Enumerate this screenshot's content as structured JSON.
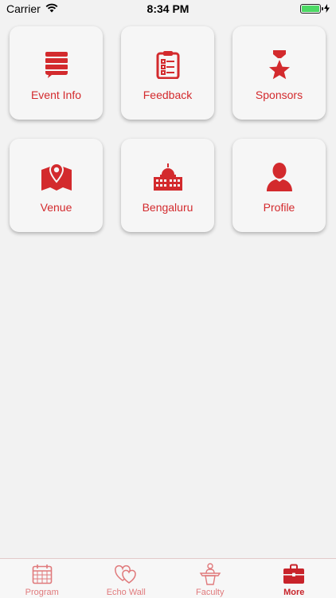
{
  "status_bar": {
    "carrier": "Carrier",
    "time": "8:34 PM",
    "battery_level": 1.0
  },
  "tiles": [
    {
      "label": "Event Info",
      "icon": "event-info-icon"
    },
    {
      "label": "Feedback",
      "icon": "clipboard-icon"
    },
    {
      "label": "Sponsors",
      "icon": "medal-icon"
    },
    {
      "label": "Venue",
      "icon": "map-pin-icon"
    },
    {
      "label": "Bengaluru",
      "icon": "building-icon"
    },
    {
      "label": "Profile",
      "icon": "person-icon"
    }
  ],
  "tab_bar": {
    "tabs": [
      {
        "label": "Program",
        "icon": "calendar-icon",
        "active": false
      },
      {
        "label": "Echo Wall",
        "icon": "hearts-icon",
        "active": false
      },
      {
        "label": "Faculty",
        "icon": "podium-icon",
        "active": false
      },
      {
        "label": "More",
        "icon": "briefcase-icon",
        "active": true
      }
    ]
  },
  "colors": {
    "accent": "#d32a2d",
    "tab_inactive": "#e07a7c",
    "background": "#f2f2f2"
  }
}
